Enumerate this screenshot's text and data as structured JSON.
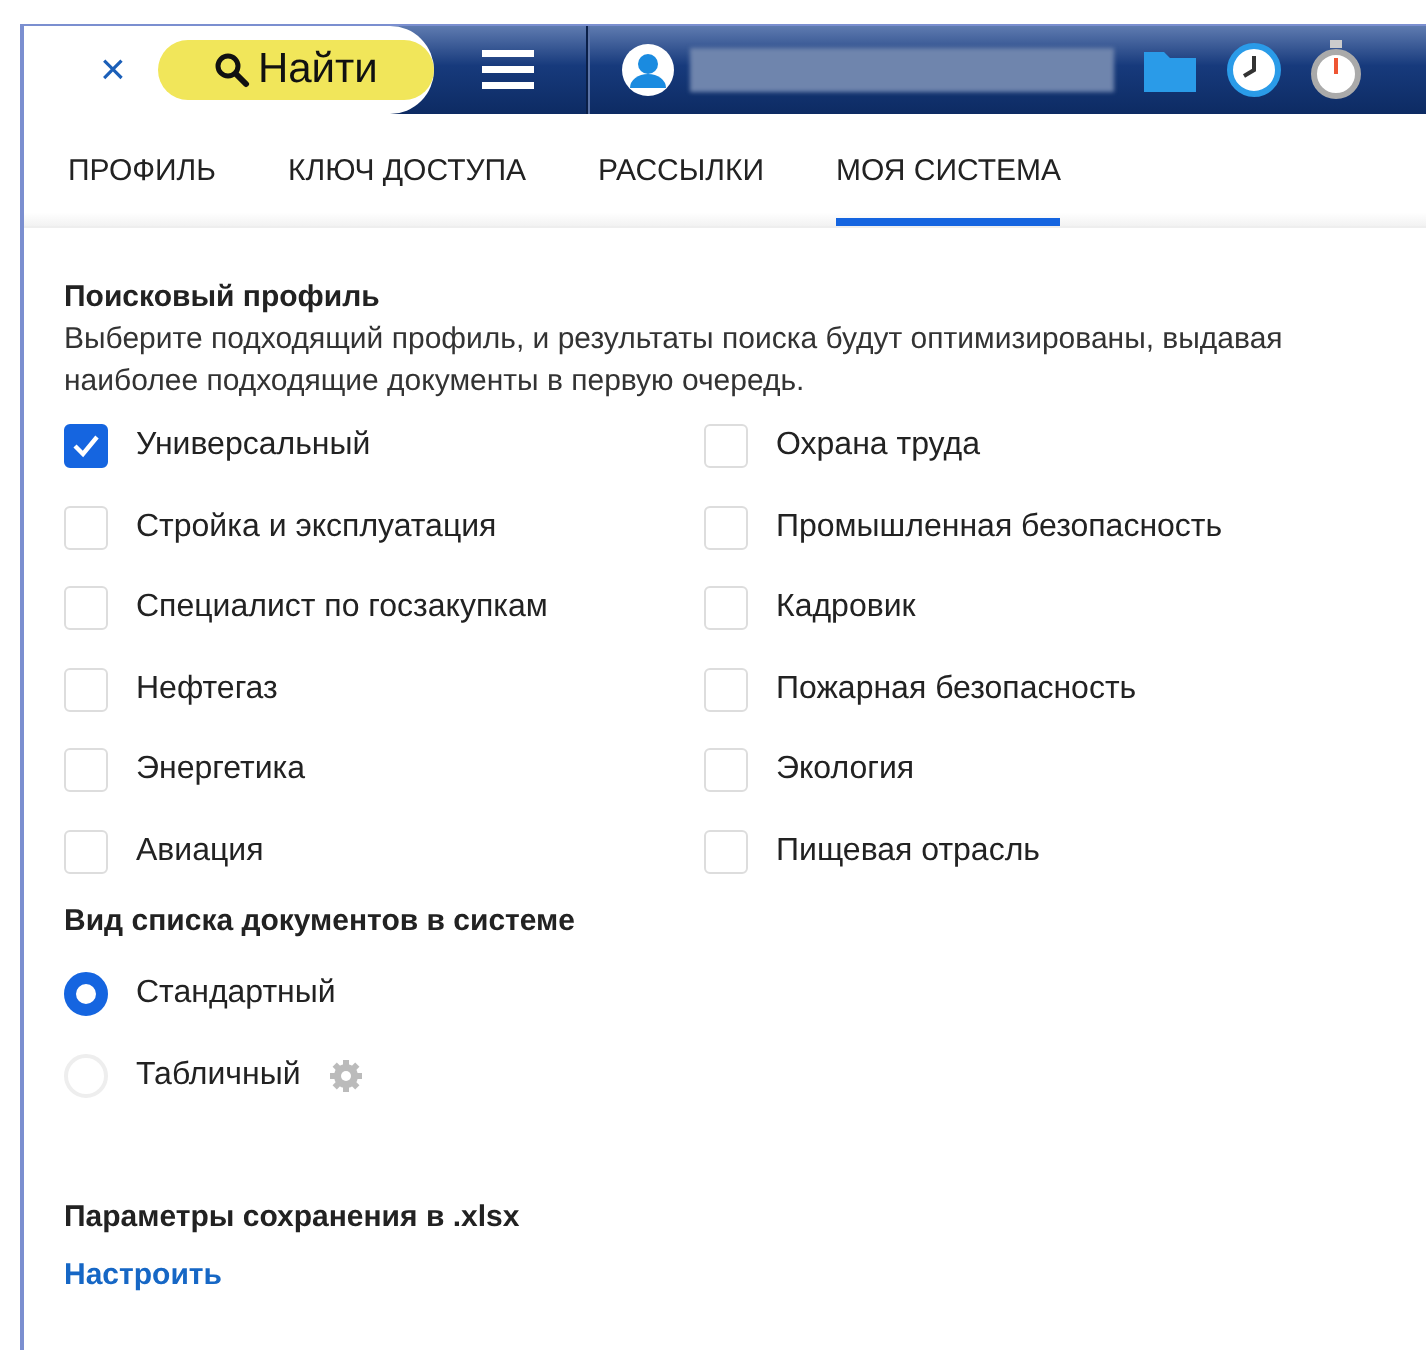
{
  "search": {
    "clear": "×",
    "button": "Найти"
  },
  "tabs": [
    {
      "label": "ПРОФИЛЬ",
      "selected": false
    },
    {
      "label": "КЛЮЧ ДОСТУПА",
      "selected": false
    },
    {
      "label": "РАССЫЛКИ",
      "selected": false
    },
    {
      "label": "МОЯ СИСТЕМА",
      "selected": true
    }
  ],
  "search_profile": {
    "title": "Поисковый профиль",
    "description": "Выберите подходящий профиль, и результаты поиска будут оптимизированы, выдавая наиболее подходящие документы в первую очередь.",
    "options": [
      {
        "label": "Универсальный",
        "checked": true
      },
      {
        "label": "Охрана труда",
        "checked": false
      },
      {
        "label": "Стройка и эксплуатация",
        "checked": false
      },
      {
        "label": "Промышленная безопасность",
        "checked": false
      },
      {
        "label": "Специалист по госзакупкам",
        "checked": false
      },
      {
        "label": "Кадровик",
        "checked": false
      },
      {
        "label": "Нефтегаз",
        "checked": false
      },
      {
        "label": "Пожарная безопасность",
        "checked": false
      },
      {
        "label": "Энергетика",
        "checked": false
      },
      {
        "label": "Экология",
        "checked": false
      },
      {
        "label": "Авиация",
        "checked": false
      },
      {
        "label": "Пищевая отрасль",
        "checked": false
      }
    ]
  },
  "list_view": {
    "title": "Вид списка документов в системе",
    "options": [
      {
        "label": "Стандартный",
        "selected": true,
        "settings": false
      },
      {
        "label": "Табличный",
        "selected": false,
        "settings": true
      }
    ]
  },
  "xlsx": {
    "title": "Параметры сохранения в .xlsx",
    "link": "Настроить"
  }
}
